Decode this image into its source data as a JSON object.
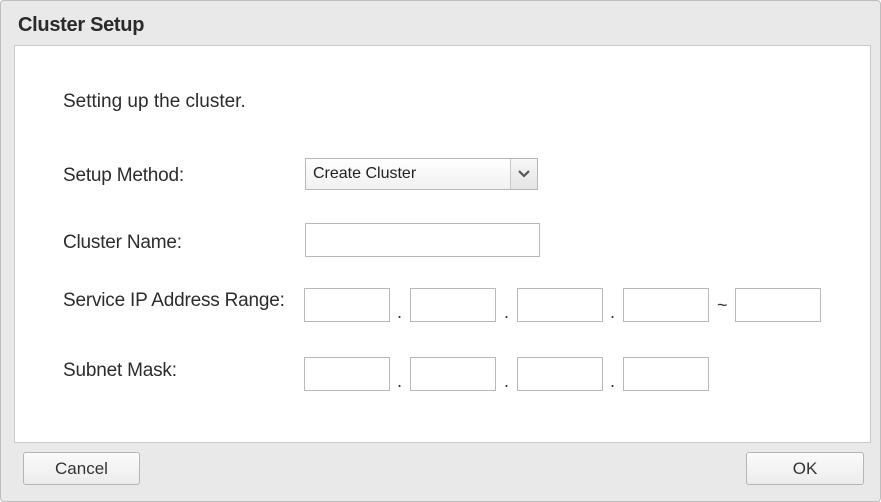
{
  "dialog": {
    "title": "Cluster Setup",
    "intro": "Setting up the cluster."
  },
  "form": {
    "setup_method": {
      "label": "Setup Method:",
      "selected": "Create Cluster"
    },
    "cluster_name": {
      "label": "Cluster Name:",
      "value": ""
    },
    "service_ip_range": {
      "label": "Service IP Address Range:",
      "octets": [
        "",
        "",
        "",
        ""
      ],
      "end_octet": "",
      "dot": ".",
      "range_separator": "~"
    },
    "subnet_mask": {
      "label": "Subnet Mask:",
      "octets": [
        "",
        "",
        "",
        ""
      ],
      "dot": "."
    }
  },
  "buttons": {
    "cancel": "Cancel",
    "ok": "OK"
  }
}
